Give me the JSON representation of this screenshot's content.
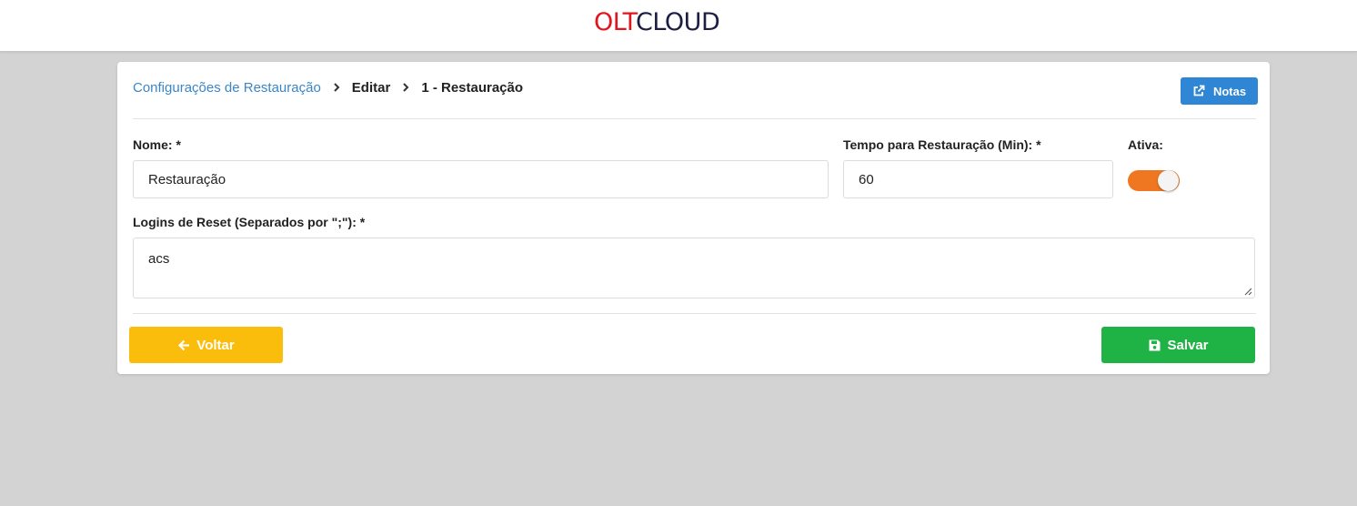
{
  "header": {
    "logo_part1": "OLT",
    "logo_part2": "CLOUD"
  },
  "breadcrumb": {
    "items": [
      {
        "label": "Configurações de Restauração",
        "link": true
      },
      {
        "label": "Editar",
        "link": false
      },
      {
        "label": "1 - Restauração",
        "link": false
      }
    ]
  },
  "toolbar": {
    "notes_label": "Notas",
    "notes_icon": "external-link-icon"
  },
  "form": {
    "name_label": "Nome: *",
    "name_value": "Restauração",
    "time_label": "Tempo para Restauração (Min): *",
    "time_value": "60",
    "active_label": "Ativa:",
    "active_value": true,
    "logins_label": "Logins de Reset (Separados por \";\"): *",
    "logins_value": "acs"
  },
  "actions": {
    "back_label": "Voltar",
    "back_icon": "arrow-left-icon",
    "save_label": "Salvar",
    "save_icon": "floppy-disk-icon"
  },
  "colors": {
    "logo_red": "#e2141e",
    "logo_navy": "#1c1e42",
    "link_blue": "#3a86c8",
    "notes_blue": "#2f86d4",
    "toggle_orange": "#f07722",
    "back_yellow": "#fbbd0b",
    "save_green": "#1fb244",
    "page_bg": "#d3d3d3"
  }
}
